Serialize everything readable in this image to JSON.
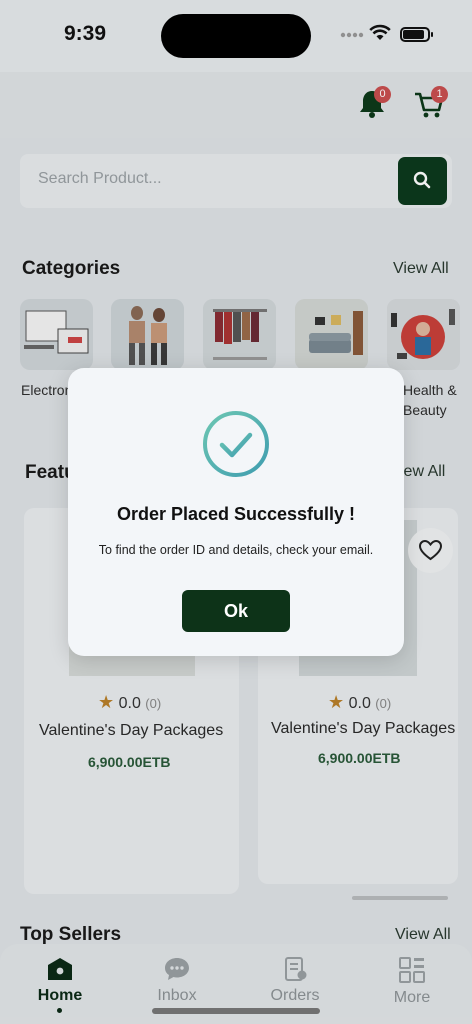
{
  "status_bar": {
    "time": "9:39"
  },
  "header": {
    "notifications_count": "0",
    "cart_count": "1"
  },
  "search": {
    "placeholder": "Search Product..."
  },
  "categories": {
    "title": "Categories",
    "view_all": "View All",
    "items": [
      {
        "label": "Electron"
      },
      {
        "label": ""
      },
      {
        "label": ""
      },
      {
        "label": ""
      },
      {
        "label": "Health &",
        "label2": "Beauty"
      }
    ]
  },
  "featured": {
    "title": "Featu",
    "view_all": "iew All",
    "products": [
      {
        "rating": "0.0",
        "reviews": "(0)",
        "name": "Valentine's Day Packages",
        "price": "6,900.00ETB"
      },
      {
        "rating": "0.0",
        "reviews": "(0)",
        "name": "Valentine's Day Packages",
        "price": "6,900.00ETB"
      }
    ]
  },
  "top_sellers": {
    "title": "Top Sellers",
    "view_all": "View All"
  },
  "bottom_nav": {
    "items": [
      {
        "label": "Home",
        "icon": "home-icon",
        "active": true
      },
      {
        "label": "Inbox",
        "icon": "chat-icon"
      },
      {
        "label": "Orders",
        "icon": "orders-icon"
      },
      {
        "label": "More",
        "icon": "grid-icon"
      }
    ]
  },
  "dialog": {
    "title": "Order Placed Successfully !",
    "message": "To find the order ID and details, check your email.",
    "ok_label": "Ok",
    "accent": "#56b8a8",
    "button_color": "#0d3318"
  }
}
